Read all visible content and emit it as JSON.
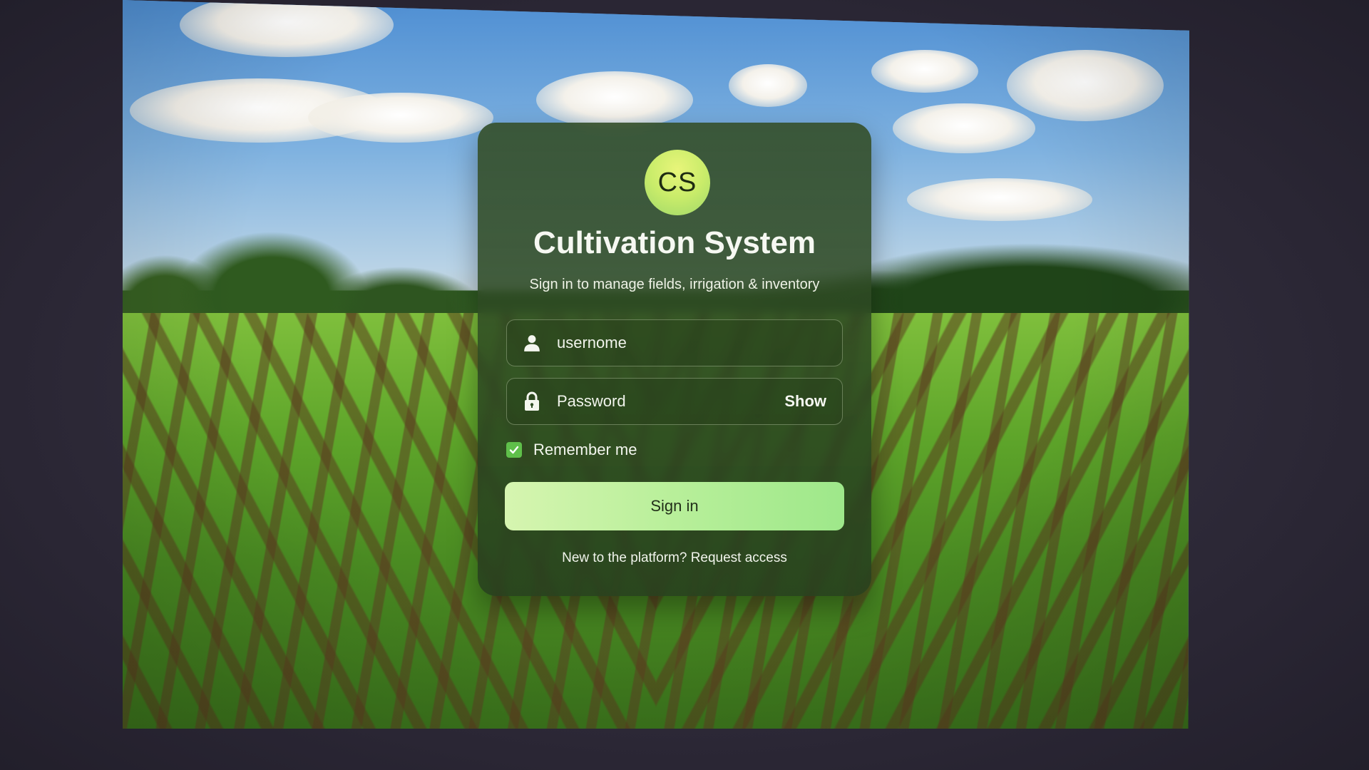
{
  "app": {
    "avatar_initials": "CS",
    "title": "Cultivation System",
    "subtitle": "Sign in to manage fields, irrigation & inventory"
  },
  "form": {
    "username_placeholder": "usernome",
    "password_placeholder": "Password",
    "show_label": "Show",
    "remember_label": "Remember me",
    "remember_checked": true,
    "signin_label": "Sign in",
    "footer_text": "New to the platform? Request access"
  },
  "icons": {
    "user": "user-icon",
    "lock": "lock-icon",
    "check": "checkmark-icon"
  },
  "colors": {
    "card_bg": "#2f4d24",
    "avatar_bg": "#d6f27a",
    "button_bg": "#b8ef9a",
    "checkbox": "#5fbf4a"
  }
}
